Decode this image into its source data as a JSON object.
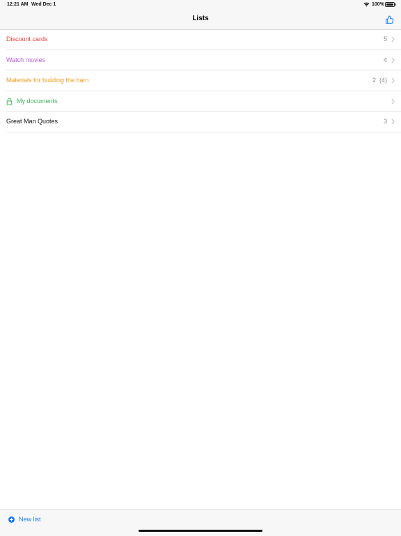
{
  "status_bar": {
    "time": "12:21 AM",
    "date": "Wed Dec 1",
    "battery": "100%"
  },
  "nav": {
    "title": "Lists",
    "right_icon": "thumbs-up-icon"
  },
  "lists": [
    {
      "label": "Discount cards",
      "count": "5",
      "color": "#e8453c",
      "locked": false
    },
    {
      "label": "Watch movies",
      "count": "4",
      "color": "#b05fd9",
      "locked": false
    },
    {
      "label": "Materials for building the barn",
      "count": "2  (4)",
      "color": "#f09a1e",
      "locked": false
    },
    {
      "label": "My documents",
      "count": "",
      "color": "#3fb55a",
      "locked": true
    },
    {
      "label": "Great Man Quotes",
      "count": "3",
      "color": "#111111",
      "locked": false
    }
  ],
  "toolbar": {
    "new_list_label": "New list",
    "accent": "#1a7cf4"
  }
}
